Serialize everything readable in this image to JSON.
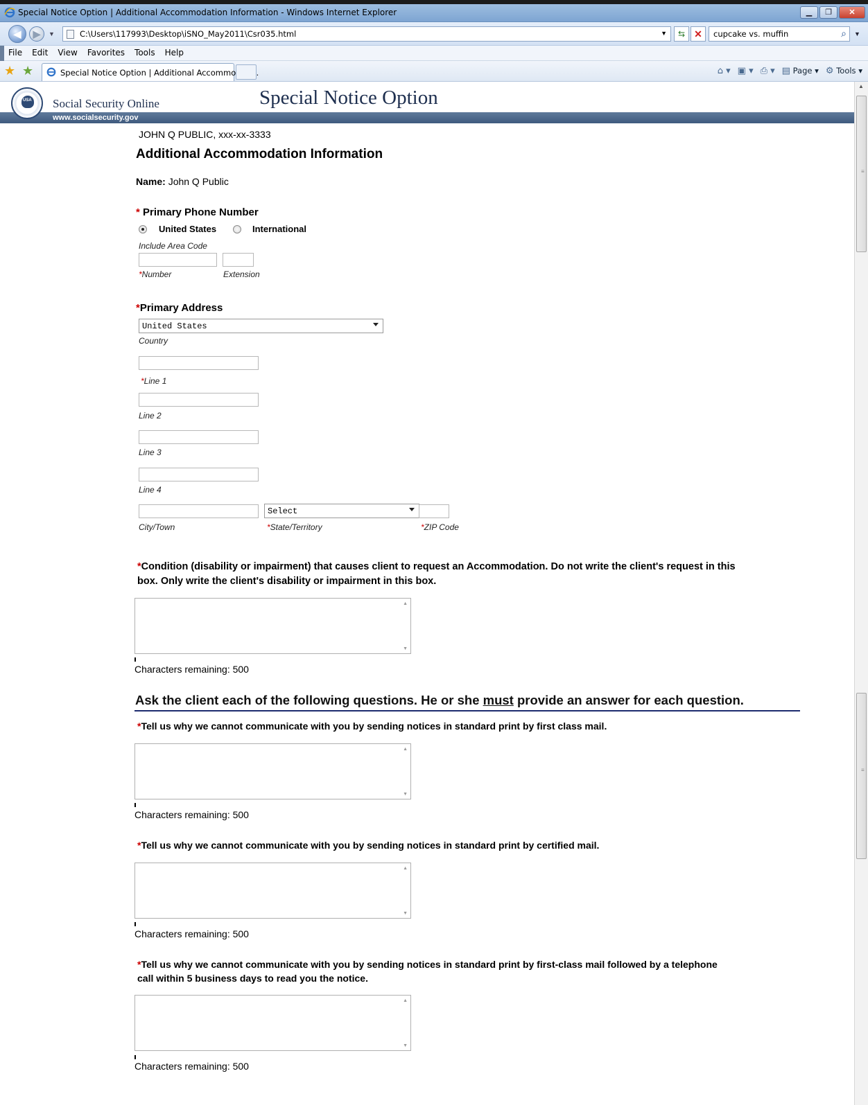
{
  "browser": {
    "window_title": "Special Notice Option | Additional Accommodation Information - Windows Internet Explorer",
    "url": "C:\\Users\\117993\\Desktop\\iSNO_May2011\\Csr035.html",
    "search_query": "cupcake vs. muffin",
    "menu": [
      "File",
      "Edit",
      "View",
      "Favorites",
      "Tools",
      "Help"
    ],
    "tab_title": "Special Notice Option | Additional Accommodati...",
    "cmd_page": "Page",
    "cmd_tools": "Tools"
  },
  "banner": {
    "site_name": "Social Security Online",
    "site_url": "www.socialsecurity.gov",
    "seal_text": "USA",
    "page_title": "Special Notice Option"
  },
  "form": {
    "client_line": "JOHN Q PUBLIC, xxx-xx-3333",
    "heading": "Additional Accommodation Information",
    "name_label": "Name:",
    "name_value": "John Q Public",
    "required_mark": "*",
    "phone": {
      "label": "Primary Phone Number",
      "option_us": "United States",
      "option_intl": "International",
      "selected": "United States",
      "hint": "Include Area Code",
      "number_caption": "Number",
      "extension_caption": "Extension"
    },
    "address": {
      "label": "Primary Address",
      "country_value": "United States",
      "country_caption": "Country",
      "line1_caption": "Line 1",
      "line2_caption": "Line 2",
      "line3_caption": "Line 3",
      "line4_caption": "Line 4",
      "city_caption": "City/Town",
      "state_value": "Select",
      "state_caption": "State/Territory",
      "zip_caption": "ZIP Code"
    },
    "condition": {
      "label_line1": "Condition (disability or impairment) that causes client to request an Accommodation. Do not write the client's request in this",
      "label_line2": "box. Only write the client's disability or impairment in this box.",
      "chars_remaining": "Characters remaining:  500"
    },
    "instructions": {
      "before": "Ask the client each of the following questions. He or she ",
      "emphasis": "must",
      "after": " provide an answer for each question."
    },
    "questions": [
      {
        "line1": "Tell us why we cannot communicate with you by sending notices in standard print by first class mail.",
        "line2": "",
        "chars_remaining": "Characters remaining:  500"
      },
      {
        "line1": "Tell us why we cannot communicate with you by sending notices in standard print by certified mail.",
        "line2": "",
        "chars_remaining": "Characters remaining:  500"
      },
      {
        "line1": "Tell us why we cannot communicate with you by sending notices in standard print by first-class mail followed by a telephone",
        "line2": "call within 5 business days to read you the notice.",
        "chars_remaining": "Characters remaining:  500"
      }
    ]
  }
}
